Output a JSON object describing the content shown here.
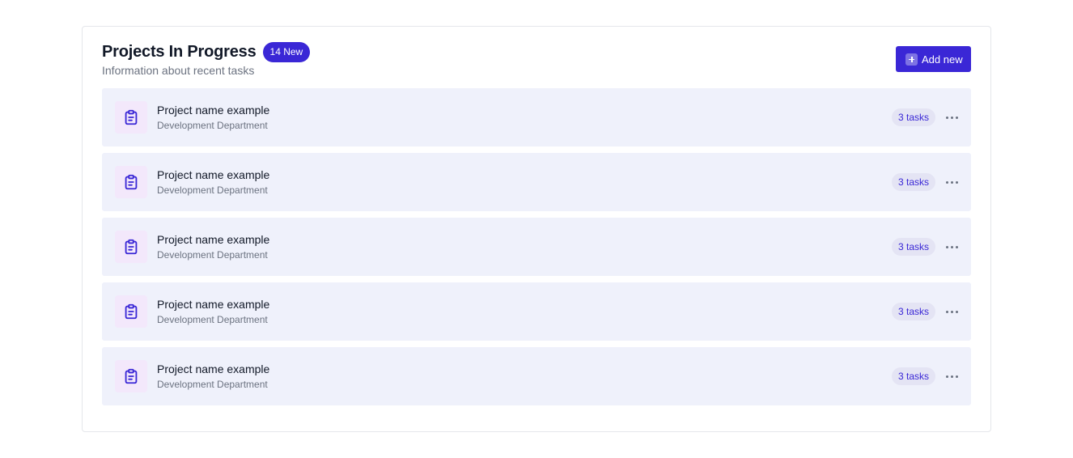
{
  "header": {
    "title": "Projects In Progress",
    "badge": "14 New",
    "subtitle": "Information about recent tasks",
    "add_button_label": "Add new"
  },
  "projects": [
    {
      "name": "Project name example",
      "department": "Development Department",
      "tasks": "3 tasks",
      "icon": "clipboard-icon"
    },
    {
      "name": "Project name example",
      "department": "Development Department",
      "tasks": "3 tasks",
      "icon": "clipboard-icon"
    },
    {
      "name": "Project name example",
      "department": "Development Department",
      "tasks": "3 tasks",
      "icon": "clipboard-icon"
    },
    {
      "name": "Project name example",
      "department": "Development Department",
      "tasks": "3 tasks",
      "icon": "clipboard-icon"
    },
    {
      "name": "Project name example",
      "department": "Development Department",
      "tasks": "3 tasks",
      "icon": "clipboard-icon"
    }
  ],
  "colors": {
    "accent": "#3a27d6",
    "row_background": "#eff1fb",
    "icon_background": "#f3e8fb",
    "muted_text": "#6b7280"
  }
}
